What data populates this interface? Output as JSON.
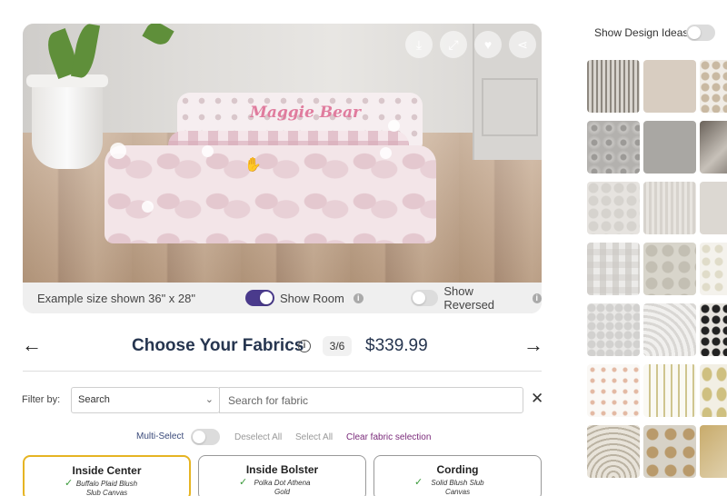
{
  "viewer": {
    "product_name_text": "Maggie Bear",
    "size_text": "Example size shown 36\" x 28\"",
    "show_room_label": "Show Room",
    "show_room_on": true,
    "show_reversed_label": "Show Reversed",
    "show_reversed_on": false,
    "tools": [
      "download-icon",
      "expand-icon",
      "heart-icon",
      "share-icon"
    ]
  },
  "heading": {
    "title": "Choose Your Fabrics",
    "step": "3/6",
    "price": "$339.99"
  },
  "filter": {
    "label": "Filter by:",
    "select_value": "Search",
    "search_placeholder": "Search for fabric"
  },
  "actions": {
    "multi_select": "Multi-Select",
    "multi_select_on": false,
    "deselect_all": "Deselect All",
    "select_all": "Select All",
    "clear_selection": "Clear fabric selection"
  },
  "cards": [
    {
      "title": "Inside Center",
      "line1": "Buffalo Plaid Blush",
      "line2": "Slub Canvas",
      "active": true
    },
    {
      "title": "Inside Bolster",
      "line1": "Polka Dot Athena",
      "line2": "Gold",
      "active": false
    },
    {
      "title": "Cording",
      "line1": "Solid Blush Slub",
      "line2": "Canvas",
      "active": false
    }
  ],
  "design_ideas": {
    "label": "Show Design Ideas",
    "on": false
  },
  "colors": {
    "title_navy": "#26354f",
    "toggle_on": "#4a3a8c",
    "active_card": "#e6b422",
    "clear_link": "#7a2a7a"
  }
}
